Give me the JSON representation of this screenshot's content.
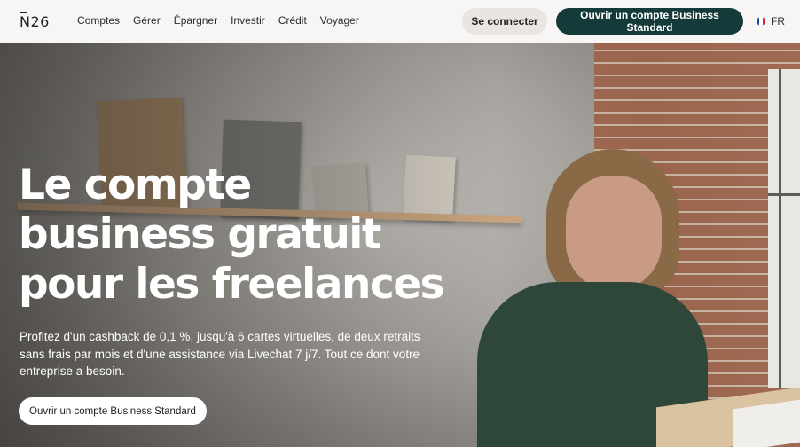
{
  "header": {
    "logo": "N26",
    "nav": [
      "Comptes",
      "Gérer",
      "Épargner",
      "Investir",
      "Crédit",
      "Voyager"
    ],
    "login_label": "Se connecter",
    "open_label": "Ouvrir un compte Business Standard",
    "language": "FR"
  },
  "hero": {
    "title_lines": [
      "Le compte",
      "business gratuit",
      "pour les freelances"
    ],
    "subtitle": "Profitez d'un cashback de 0,1 %, jusqu'à 6 cartes virtuelles, de deux retraits sans frais par mois et d'une assistance via Livechat 7 j/7. Tout ce dont votre entreprise a besoin.",
    "cta_label": "Ouvrir un compte Business Standard"
  },
  "colors": {
    "accent": "#143b3a",
    "login_bg": "#e9e6e1"
  }
}
